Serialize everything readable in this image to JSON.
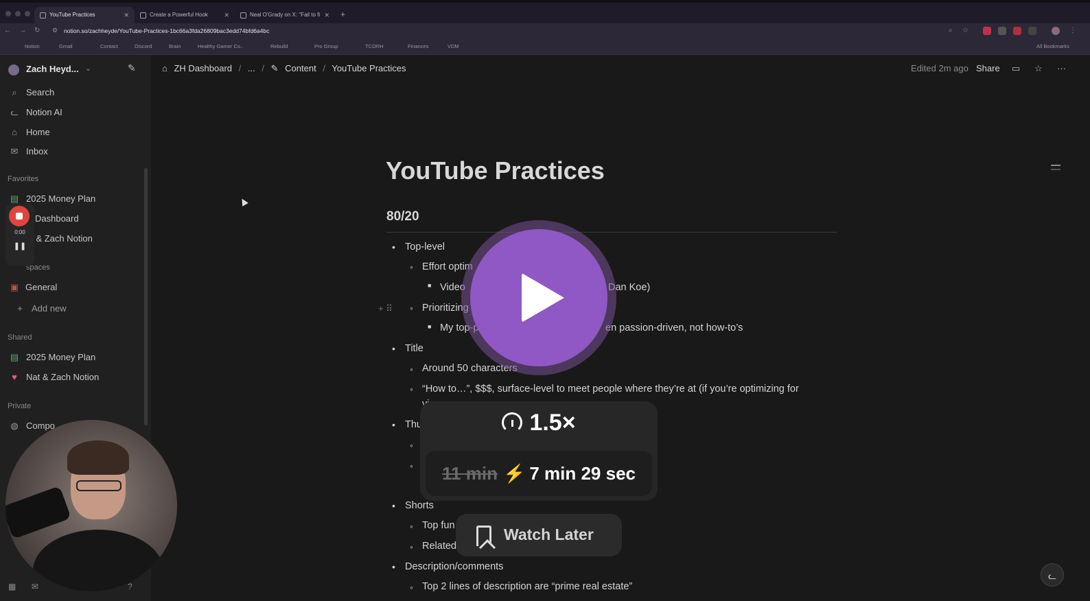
{
  "browser": {
    "tabs": [
      {
        "title": "YouTube Practices",
        "active": true
      },
      {
        "title": "Create a Powerful Hook",
        "active": false
      },
      {
        "title": "Neal O'Grady on X: \"Fail to fi",
        "active": false
      }
    ],
    "url": "notion.so/zachheyde/YouTube-Practices-1bc66a3fda26809bac3edd74bfd6a4bc",
    "bookmarks": [
      "Notion",
      "Gmail",
      "Contact",
      "Discord",
      "Brain",
      "Healthy Gamer Co..",
      "Rebuild",
      "Pro Group",
      "TCORH",
      "Finances",
      "VDM"
    ],
    "all_bookmarks": "All Bookmarks"
  },
  "sidebar": {
    "workspace": "Zach Heyd...",
    "nav": [
      {
        "label": "Search",
        "icon": "search-icon"
      },
      {
        "label": "Notion AI",
        "icon": "notion-ai-icon"
      },
      {
        "label": "Home",
        "icon": "home-icon"
      },
      {
        "label": "Inbox",
        "icon": "inbox-icon"
      }
    ],
    "favorites_header": "Favorites",
    "favorites": [
      "2025 Money Plan",
      "H Dashboard",
      "at & Zach Notion"
    ],
    "spaces_header": "spaces",
    "spaces": [
      "General",
      "Add new"
    ],
    "shared_header": "Shared",
    "shared": [
      "2025 Money Plan",
      "Nat & Zach Notion"
    ],
    "private_header": "Private",
    "private": [
      "Compo"
    ]
  },
  "recorder": {
    "time": "0:00"
  },
  "topbar": {
    "crumbs": [
      "ZH Dashboard",
      "...",
      "Content",
      "YouTube Practices"
    ],
    "edited": "Edited 2m ago",
    "share": "Share"
  },
  "page": {
    "title": "YouTube Practices",
    "heading": "80/20",
    "lines": {
      "l1": "Top-level",
      "l2": "Effort optim",
      "l3": "Video",
      "l3b": "Dan Koe)",
      "l4": "Prioritizing",
      "l5": "My top-p",
      "l5b": "en passion-driven, not how-to’s",
      "l6": "Title",
      "l7": "Around 50 characters",
      "l8": "“How to…”, $$$, surface-level to meet people where they’re at (if you’re optimizing for",
      "l8b": "vi",
      "l9": "Thu",
      "l10": "Shorts",
      "l11": "Top fun",
      "l12": "Related",
      "l13": "Description/comments",
      "l14": "Top 2 lines of description are “prime real estate”"
    }
  },
  "overlay": {
    "speed": "1.5×",
    "old_time": "11 min",
    "new_time": "7 min 29 sec",
    "watch_later": "Watch Later"
  },
  "colors": {
    "accent": "#8f58c4",
    "record": "#e0443e",
    "bolt": "#f5a623"
  }
}
